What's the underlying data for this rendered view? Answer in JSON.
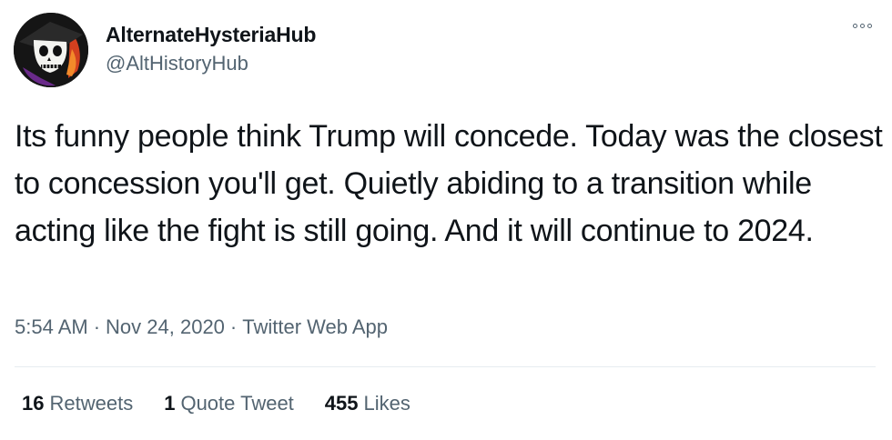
{
  "author": {
    "display_name": "AlternateHysteriaHub",
    "handle": "@AltHistoryHub",
    "avatar_icon": "skull-avatar-icon"
  },
  "tweet": {
    "text": "Its funny people think Trump will concede. Today was the closest to concession you'll get. Quietly abiding to a transition while acting like the fight is still going. And it will continue to 2024.",
    "time": "5:54 AM",
    "date": "Nov 24, 2020",
    "source": "Twitter Web App",
    "separator": "·"
  },
  "stats": {
    "retweets_count": "16",
    "retweets_label": "Retweets",
    "quotes_count": "1",
    "quotes_label": "Quote Tweet",
    "likes_count": "455",
    "likes_label": "Likes"
  },
  "colors": {
    "text": "#0f1419",
    "secondary": "#536471",
    "divider": "#e6ecf0"
  }
}
